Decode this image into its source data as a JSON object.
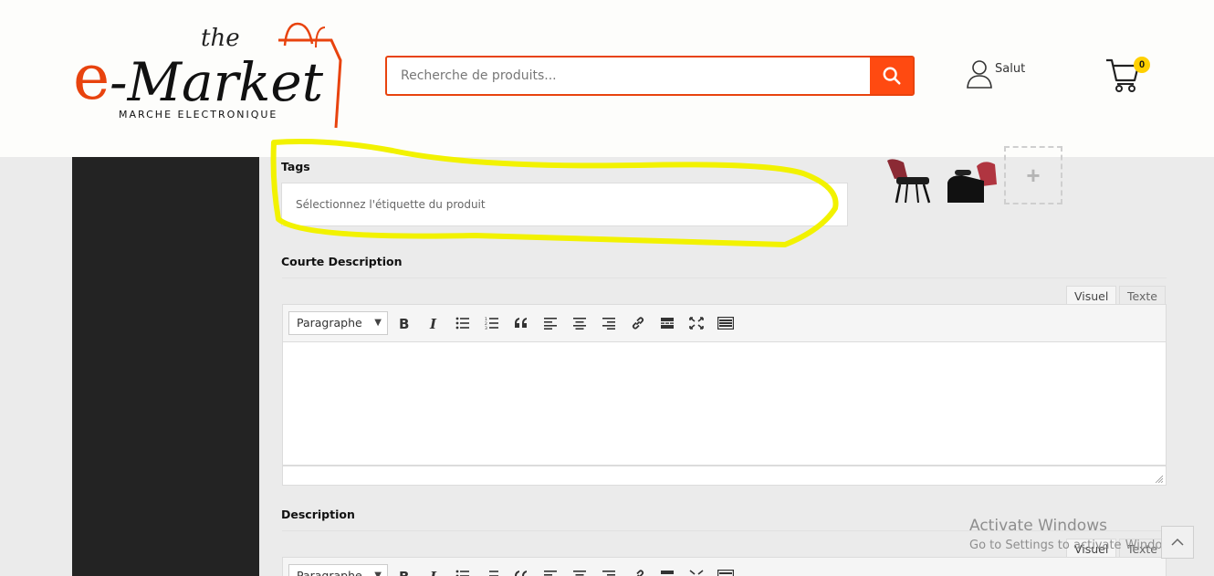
{
  "brand": {
    "logo_the": "the",
    "logo_name": "e-Market",
    "logo_tagline": "MARCHE ELECTRONIQUE",
    "accent_color": "#ff4a11"
  },
  "search": {
    "placeholder": "Recherche de produits...",
    "button_icon": "search-icon"
  },
  "account": {
    "greeting": "Salut",
    "icon": "user-icon"
  },
  "cart": {
    "icon": "cart-icon",
    "count": "0"
  },
  "form": {
    "tags_label": "Tags",
    "tags_placeholder": "Sélectionnez l'étiquette du produit",
    "add_image_symbol": "+",
    "short_description_label": "Courte Description",
    "description_label": "Description"
  },
  "editor": {
    "tab_visual": "Visuel",
    "tab_text": "Texte",
    "format_value": "Paragraphe",
    "toolbar_buttons": [
      "bold-icon",
      "italic-icon",
      "bullet-list-icon",
      "numbered-list-icon",
      "blockquote-icon",
      "align-left-icon",
      "align-center-icon",
      "align-right-icon",
      "link-icon",
      "read-more-icon",
      "fullscreen-icon",
      "keyboard-icon"
    ]
  },
  "watermark": {
    "line1": "Activate Windows",
    "line2": "Go to Settings to activate Windows."
  },
  "highlight_color": "#f2f200"
}
